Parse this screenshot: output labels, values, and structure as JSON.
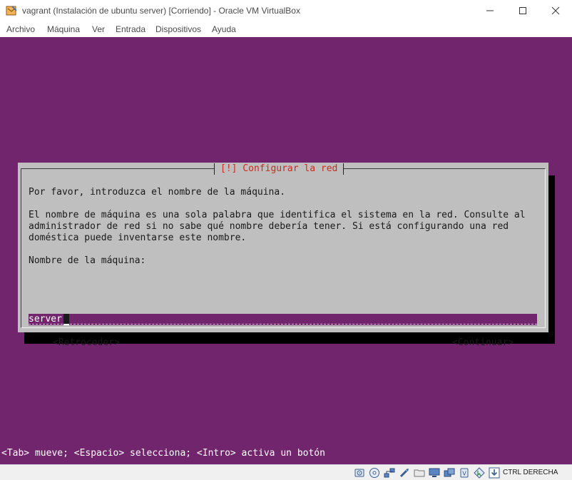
{
  "window": {
    "title": "vagrant (Instalación de ubuntu server) [Corriendo] - Oracle VM VirtualBox"
  },
  "menu": [
    "Archivo",
    "Máquina",
    "Ver",
    "Entrada",
    "Dispositivos",
    "Ayuda"
  ],
  "dialog": {
    "title": "[!] Configurar la red",
    "prompt": "Por favor, introduzca el nombre de la máquina.",
    "description": [
      "El nombre de máquina es una sola palabra que identifica el sistema en la red. Consulte al",
      "administrador de red si no sabe qué nombre debería tener. Si está configurando una red",
      "doméstica puede inventarse este nombre."
    ],
    "field_label": "Nombre de la máquina:",
    "field_value": "server",
    "back_button": "<Retroceder>",
    "continue_button": "<Continuar>"
  },
  "hint_bar": "<Tab> mueve; <Espacio> selecciona; <Intro> activa un botón",
  "statusbar": {
    "icons": [
      "hard-disk-icon",
      "optical-drive-icon",
      "network-icon",
      "usb-icon",
      "shared-folders-icon",
      "display-icon",
      "video-capture-icon",
      "cpu-virtualization-icon",
      "mouse-integration-icon",
      "keyboard-capture-icon"
    ],
    "host_key": "CTRL DERECHA"
  },
  "colors": {
    "console_bg": "#71256d",
    "dialog_bg": "#bfbfbf",
    "dialog_title": "#cc2a1e"
  }
}
